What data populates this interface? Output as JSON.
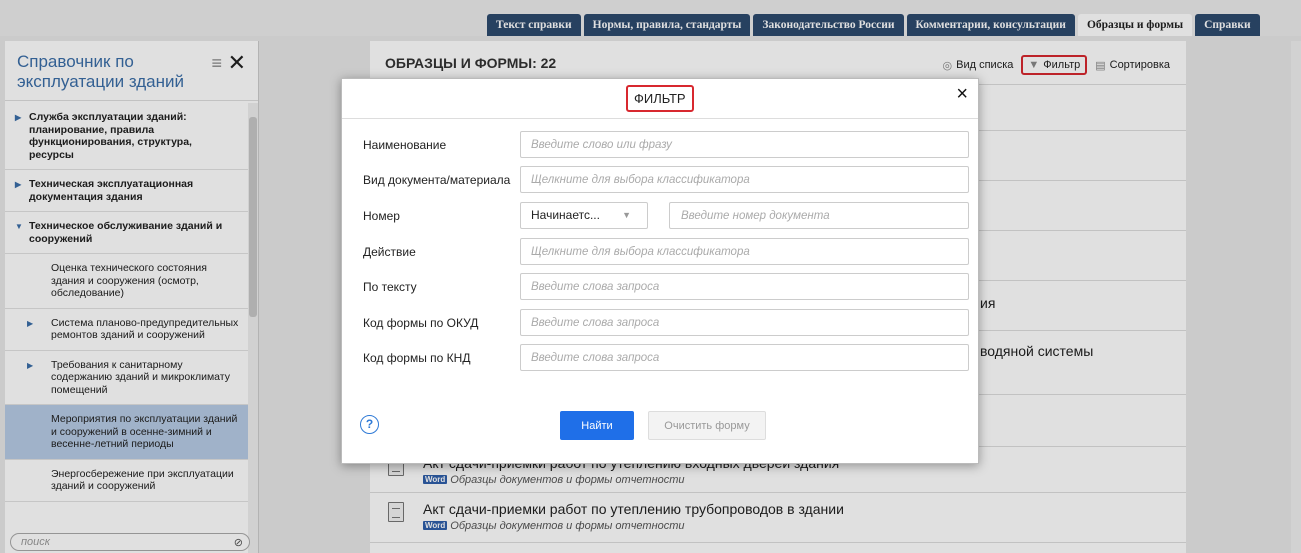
{
  "top_tabs": [
    {
      "label": "Текст справки",
      "active": false
    },
    {
      "label": "Нормы, правила, стандарты",
      "active": false
    },
    {
      "label": "Законодательство России",
      "active": false
    },
    {
      "label": "Комментарии, консультации",
      "active": false
    },
    {
      "label": "Образцы и формы",
      "active": true
    },
    {
      "label": "Справки",
      "active": false
    }
  ],
  "sidebar": {
    "title": "Справочник по эксплуатации зданий",
    "search_placeholder": "поиск",
    "items": [
      {
        "label": "Служба эксплуатации зданий: планирование, правила функционирования, структура, ресурсы",
        "bold": true,
        "arrow": "▶"
      },
      {
        "label": "Техническая эксплуатационная документация здания",
        "bold": true,
        "arrow": "▶"
      },
      {
        "label": "Техническое обслуживание зданий и сооружений",
        "bold": true,
        "arrow": "▼"
      },
      {
        "label": "Оценка технического состояния здания и сооружения (осмотр, обследование)",
        "bold": false,
        "arrow": ""
      },
      {
        "label": "Система планово-предупредительных ремонтов зданий и сооружений",
        "bold": false,
        "arrow": "▶"
      },
      {
        "label": "Требования к санитарному содержанию зданий и микроклимату помещений",
        "bold": false,
        "arrow": "▶"
      },
      {
        "label": "Мероприятия по эксплуатации зданий и сооружений в осенне-зимний и весенне-летний периоды",
        "bold": false,
        "arrow": "",
        "selected": true
      },
      {
        "label": "Энергосбережение при эксплуатации зданий и сооружений",
        "bold": false,
        "arrow": ""
      }
    ]
  },
  "main": {
    "title": "ОБРАЗЦЫ И ФОРМЫ: 22",
    "tools": {
      "list_view": "Вид списка",
      "filter": "Фильтр",
      "sort": "Сортировка"
    },
    "fragments": [
      "ия",
      "водяной системы"
    ],
    "rows": [
      {
        "title": "Акт сдачи-приемки работ по утеплению входных дверей здания",
        "subtitle": "Образцы документов и формы отчетности"
      },
      {
        "title": "Акт сдачи-приемки работ по утеплению трубопроводов в здании",
        "subtitle": "Образцы документов и формы отчетности"
      }
    ],
    "word_badge": "Word"
  },
  "modal": {
    "title": "ФИЛЬТР",
    "close": "×",
    "fields": {
      "name": {
        "label": "Наименование",
        "placeholder": "Введите слово или фразу"
      },
      "doc_type": {
        "label": "Вид документа/материала",
        "placeholder": "Щелкните для выбора классификатора"
      },
      "number": {
        "label": "Номер",
        "select_value": "Начинаетс...",
        "placeholder": "Введите номер документа"
      },
      "action": {
        "label": "Действие",
        "placeholder": "Щелкните для выбора классификатора"
      },
      "by_text": {
        "label": "По тексту",
        "placeholder": "Введите слова запроса"
      },
      "okud": {
        "label": "Код формы по ОКУД",
        "placeholder": "Введите слова запроса"
      },
      "knd": {
        "label": "Код формы по КНД",
        "placeholder": "Введите слова запроса"
      }
    },
    "help": "?",
    "find_button": "Найти",
    "clear_button": "Очистить форму"
  }
}
